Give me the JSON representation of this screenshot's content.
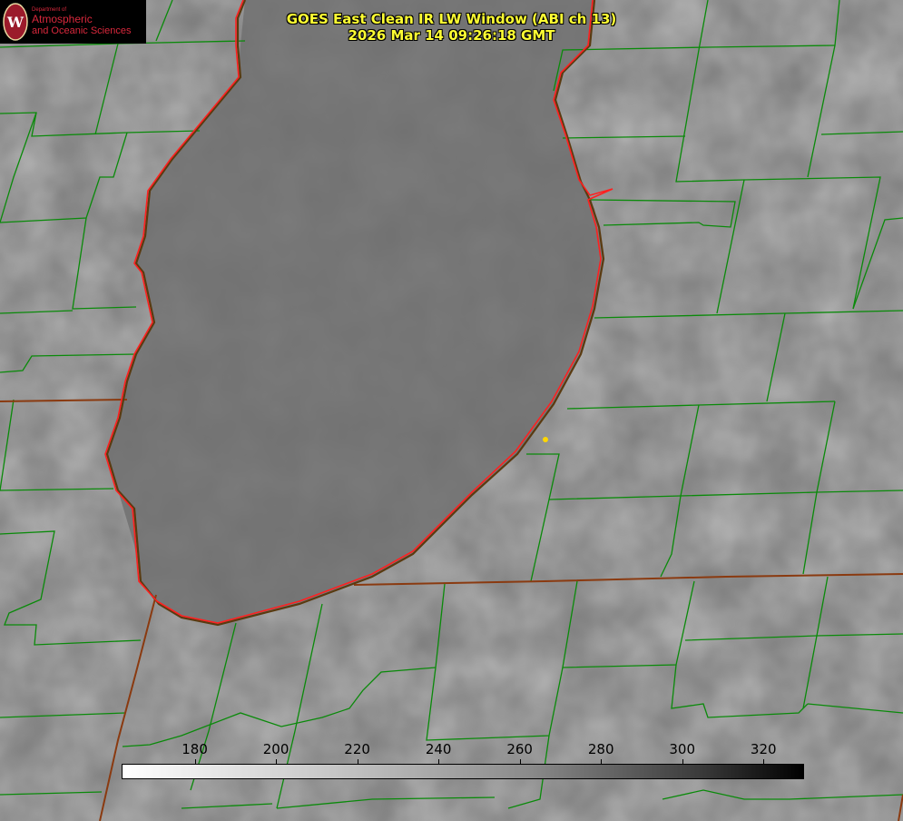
{
  "title": {
    "line1": "GOES East Clean IR LW Window (ABI ch 13)",
    "line2": "2026 Mar 14 09:26:18 GMT"
  },
  "logo": {
    "department": "Department of",
    "line1": "Atmospheric",
    "line2": "and Oceanic Sciences",
    "emblem": "W"
  },
  "colorbar": {
    "ticks": [
      "180",
      "200",
      "220",
      "240",
      "260",
      "280",
      "300",
      "320"
    ],
    "min_value": 162,
    "max_value": 330
  },
  "colors": {
    "title": "#ffff33",
    "county_lines": "#0a8a0a",
    "coastline": "#ff2020",
    "state_lines": "#8a3a10",
    "marker": "#ffd700"
  }
}
